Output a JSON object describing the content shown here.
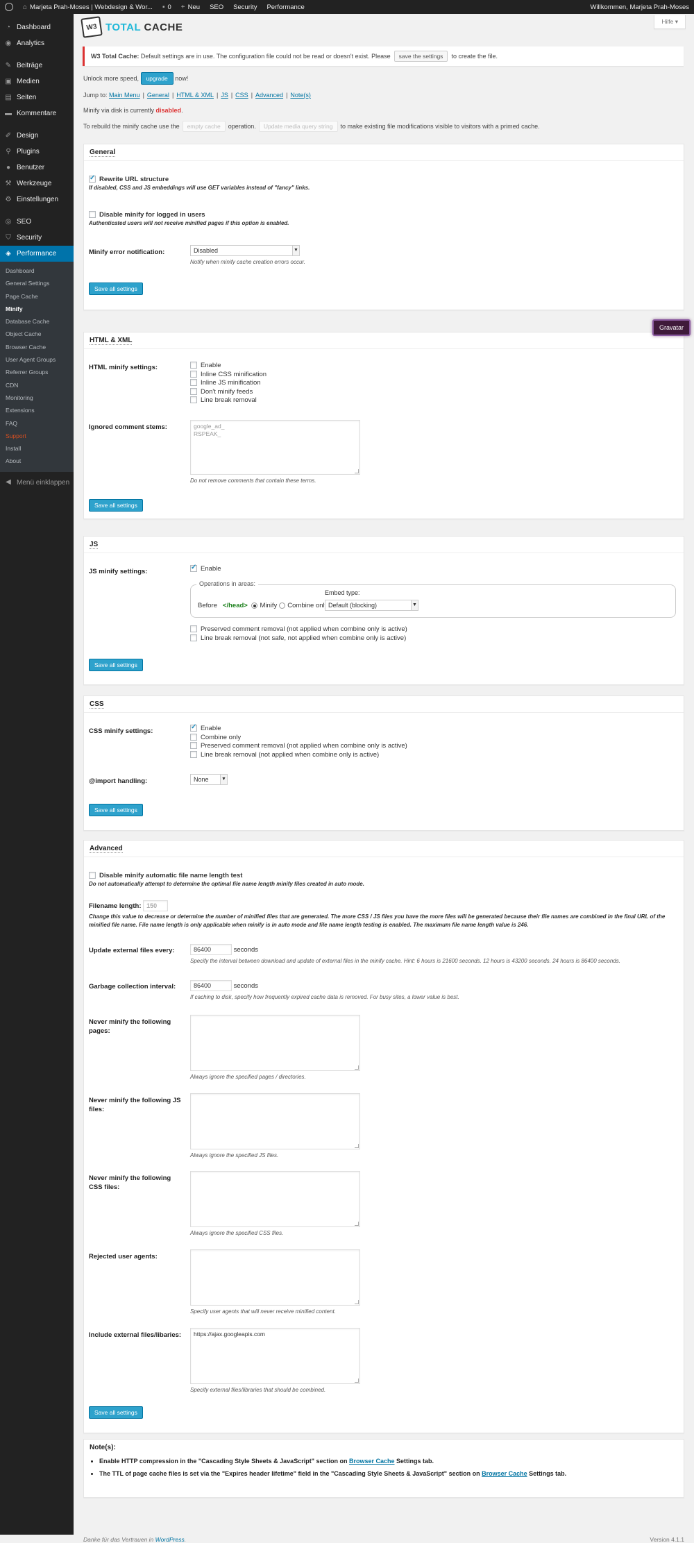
{
  "adminbar": {
    "site_name": "Marjeta Prah-Moses | Webdesign & Wor...",
    "comments_count": "0",
    "new_label": "Neu",
    "seo_label": "SEO",
    "security_label": "Security",
    "performance_label": "Performance",
    "greeting": "Willkommen, Marjeta Prah-Moses"
  },
  "sidebar": {
    "items": [
      {
        "label": "Dashboard",
        "icon": "dashboard-icon"
      },
      {
        "label": "Analytics",
        "icon": "analytics-icon"
      },
      {
        "label": "Beiträge",
        "icon": "pin-icon"
      },
      {
        "label": "Medien",
        "icon": "media-icon"
      },
      {
        "label": "Seiten",
        "icon": "page-icon"
      },
      {
        "label": "Kommentare",
        "icon": "comment-icon"
      },
      {
        "label": "Design",
        "icon": "brush-icon"
      },
      {
        "label": "Plugins",
        "icon": "plugin-icon"
      },
      {
        "label": "Benutzer",
        "icon": "user-icon"
      },
      {
        "label": "Werkzeuge",
        "icon": "wrench-icon"
      },
      {
        "label": "Einstellungen",
        "icon": "settings-icon"
      },
      {
        "label": "SEO",
        "icon": "seo-icon"
      },
      {
        "label": "Security",
        "icon": "shield-icon"
      },
      {
        "label": "Performance",
        "icon": "performance-icon"
      }
    ],
    "submenu": [
      "Dashboard",
      "General Settings",
      "Page Cache",
      "Minify",
      "Database Cache",
      "Object Cache",
      "Browser Cache",
      "User Agent Groups",
      "Referrer Groups",
      "CDN",
      "Monitoring",
      "Extensions",
      "FAQ",
      "Support",
      "Install",
      "About"
    ],
    "collapse_label": "Menü einklappen"
  },
  "header": {
    "help_label": "Hilfe",
    "logo_w3": "W3",
    "logo_total": "TOTAL",
    "logo_cache": "CACHE"
  },
  "notice": {
    "strong": "W3 Total Cache:",
    "text": "Default settings are in use. The configuration file could not be read or doesn't exist. Please",
    "button": "save the settings",
    "after": "to create the file."
  },
  "upgrade": {
    "before": "Unlock more speed,",
    "button": "upgrade",
    "after": "now!"
  },
  "jump": {
    "prefix": "Jump to:",
    "links": [
      "Main Menu",
      "General",
      "HTML & XML",
      "JS",
      "CSS",
      "Advanced",
      "Note(s)"
    ]
  },
  "status": {
    "before": "Minify via disk is currently",
    "state": "disabled",
    "after": "."
  },
  "rebuild": {
    "before": "To rebuild the minify cache use the",
    "empty_button": "empty cache",
    "middle": "operation.",
    "update_button": "Update media query string",
    "after": "to make existing file modifications visible to visitors with a primed cache."
  },
  "save_all_label": "Save all settings",
  "general": {
    "title": "General",
    "rewrite_label": "Rewrite URL structure",
    "rewrite_desc": "If disabled, CSS and JS embeddings will use GET variables instead of \"fancy\" links.",
    "disable_logged_label": "Disable minify for logged in users",
    "disable_logged_desc": "Authenticated users will not receive minified pages if this option is enabled.",
    "error_label": "Minify error notification:",
    "error_value": "Disabled",
    "error_desc": "Notify when minify cache creation errors occur."
  },
  "html": {
    "title": "HTML & XML",
    "settings_label": "HTML minify settings:",
    "options": [
      "Enable",
      "Inline CSS minification",
      "Inline JS minification",
      "Don't minify feeds",
      "Line break removal"
    ],
    "ignored_label": "Ignored comment stems:",
    "ignored_value": "google_ad_\nRSPEAK_",
    "ignored_desc": "Do not remove comments that contain these terms."
  },
  "gravatar_label": "Gravatar",
  "js": {
    "title": "JS",
    "settings_label": "JS minify settings:",
    "enable_label": "Enable",
    "legend": "Operations in areas:",
    "embed_type_label": "Embed type:",
    "before_label": "Before",
    "head_tag": "</head>",
    "minify_label": "Minify",
    "combine_label": "Combine only",
    "embed_value": "Default (blocking)",
    "preserved_label": "Preserved comment removal (not applied when combine only is active)",
    "linebreak_label": "Line break removal (not safe, not applied when combine only is active)"
  },
  "css": {
    "title": "CSS",
    "settings_label": "CSS minify settings:",
    "options": [
      "Enable",
      "Combine only",
      "Preserved comment removal (not applied when combine only is active)",
      "Line break removal (not applied when combine only is active)"
    ],
    "import_label": "@import handling:",
    "import_value": "None"
  },
  "advanced": {
    "title": "Advanced",
    "disable_test_label": "Disable minify automatic file name length test",
    "disable_test_desc": "Do not automatically attempt to determine the optimal file name length minify files created in auto mode.",
    "filename_label": "Filename length:",
    "filename_value": "150",
    "filename_desc": "Change this value to decrease or determine the number of minified files that are generated. The more CSS / JS files you have the more files will be generated because their file names are combined in the final URL of the minified file name. File name length is only applicable when minify is in auto mode and file name length testing is enabled. The maximum file name length value is 246.",
    "update_label": "Update external files every:",
    "update_value": "86400",
    "seconds": "seconds",
    "update_desc": "Specify the interval between download and update of external files in the minify cache. Hint: 6 hours is 21600 seconds. 12 hours is 43200 seconds. 24 hours is 86400 seconds.",
    "gc_label": "Garbage collection interval:",
    "gc_value": "86400",
    "gc_desc": "If caching to disk, specify how frequently expired cache data is removed. For busy sites, a lower value is best.",
    "never_pages_label": "Never minify the following pages:",
    "never_pages_desc": "Always ignore the specified pages / directories.",
    "never_js_label": "Never minify the following JS files:",
    "never_js_desc": "Always ignore the specified JS files.",
    "never_css_label": "Never minify the following CSS files:",
    "never_css_desc": "Always ignore the specified CSS files.",
    "rejected_label": "Rejected user agents:",
    "rejected_desc": "Specify user agents that will never receive minified content.",
    "include_label": "Include external files/libaries:",
    "include_value": "https://ajax.googleapis.com",
    "include_desc": "Specify external files/libraries that should be combined."
  },
  "notes": {
    "title": "Note(s):",
    "n1_before": "Enable HTTP compression in the \"Cascading Style Sheets & JavaScript\" section on",
    "n1_link": "Browser Cache",
    "n1_after": "Settings tab.",
    "n2_before": "The TTL of page cache files is set via the \"Expires header lifetime\" field in the \"Cascading Style Sheets & JavaScript\" section on",
    "n2_link": "Browser Cache",
    "n2_after": "Settings tab."
  },
  "footer": {
    "thanks": "Danke für das Vertrauen in",
    "wp_link": "WordPress",
    "period": ".",
    "version": "Version 4.1.1"
  }
}
